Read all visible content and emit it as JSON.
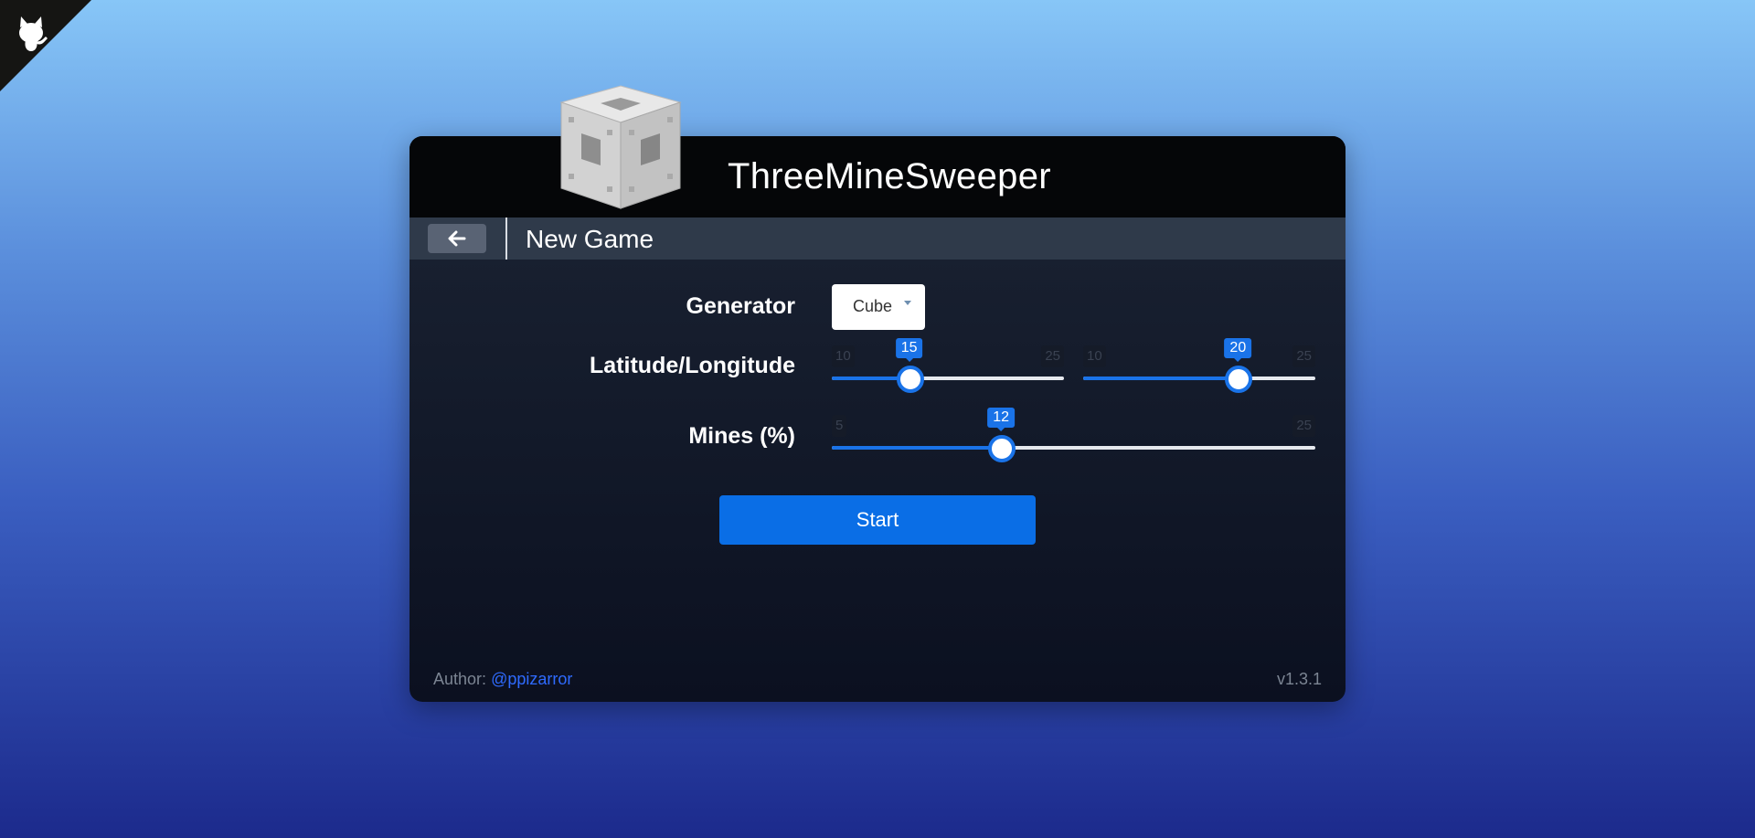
{
  "app": {
    "title": "ThreeMineSweeper"
  },
  "subbar": {
    "title": "New Game",
    "back_icon": "arrow-left-icon"
  },
  "form": {
    "generator": {
      "label": "Generator",
      "value": "Cube"
    },
    "latlon": {
      "label": "Latitude/Longitude",
      "latitude": {
        "min": "10",
        "max": "25",
        "value": "15",
        "level": 15,
        "range": [
          10,
          25
        ]
      },
      "longitude": {
        "min": "10",
        "max": "25",
        "value": "20",
        "level": 20,
        "range": [
          10,
          25
        ]
      }
    },
    "mines": {
      "label": "Mines (%)",
      "min": "5",
      "max": "25",
      "value": "12",
      "level": 12,
      "range": [
        5,
        25
      ]
    },
    "start_label": "Start"
  },
  "footer": {
    "author_prefix": "Author:",
    "author_handle": "@ppizarror",
    "version": "v1.3.1"
  },
  "colors": {
    "accent": "#1a73e8",
    "header_bg": "#050608",
    "subbar_bg": "#2f3a4a",
    "start_button": "#0a6ee6",
    "link": "#2f6bff"
  },
  "icons": {
    "corner": "github-octocat-icon",
    "logo": "menger-cube-logo"
  }
}
